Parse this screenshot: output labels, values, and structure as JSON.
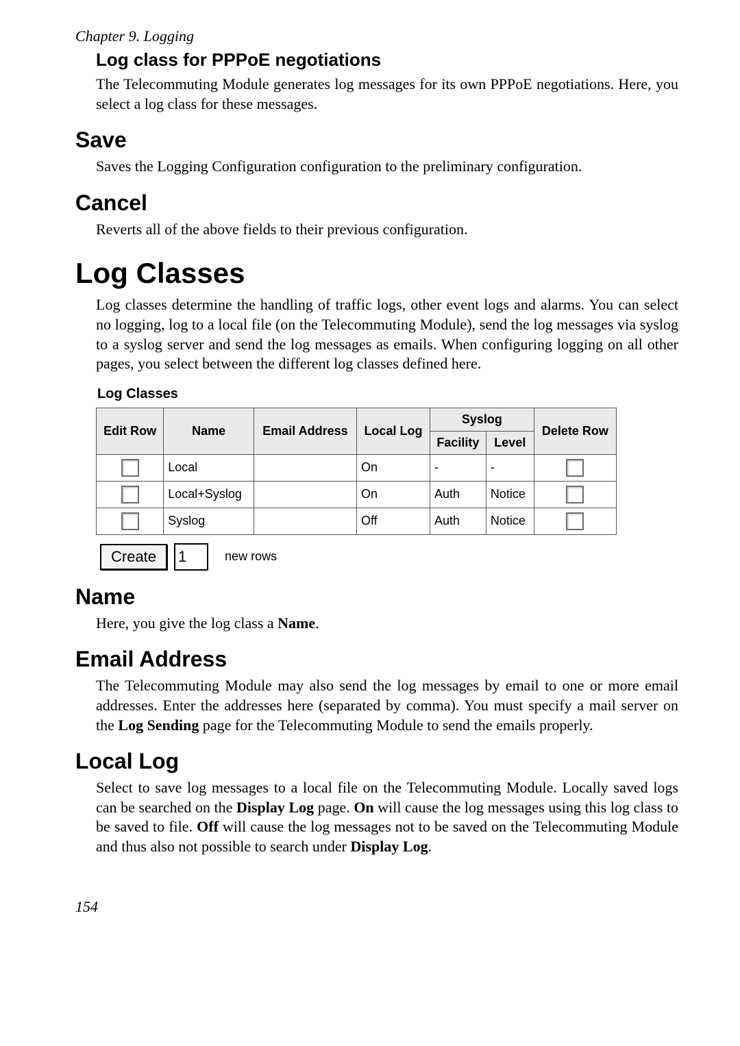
{
  "chapter": "Chapter 9. Logging",
  "section_pppoe": {
    "title": "Log class for PPPoE negotiations",
    "body": "The Telecommuting Module generates log messages for its own PPPoE negotiations. Here, you select a log class for these messages."
  },
  "section_save": {
    "title": "Save",
    "body": "Saves the Logging Configuration configuration to the preliminary configuration."
  },
  "section_cancel": {
    "title": "Cancel",
    "body": "Reverts all of the above fields to their previous configuration."
  },
  "section_logclasses": {
    "title": "Log Classes",
    "intro": "Log classes determine the handling of traffic logs, other event logs and alarms. You can select no logging, log to a local file (on the Telecommuting Module), send the log messages via syslog to a syslog server and send the log messages as emails. When configuring logging on all other pages, you select between the different log classes defined here.",
    "widget": {
      "title": "Log Classes",
      "headers": {
        "edit_row": "Edit Row",
        "name": "Name",
        "email": "Email Address",
        "local_log": "Local Log",
        "syslog": "Syslog",
        "facility": "Facility",
        "level": "Level",
        "delete_row": "Delete Row"
      },
      "rows": [
        {
          "name": "Local",
          "email": "",
          "local_log": "On",
          "facility": "-",
          "level": "-"
        },
        {
          "name": "Local+Syslog",
          "email": "",
          "local_log": "On",
          "facility": "Auth",
          "level": "Notice"
        },
        {
          "name": "Syslog",
          "email": "",
          "local_log": "Off",
          "facility": "Auth",
          "level": "Notice"
        }
      ],
      "create_button": "Create",
      "create_value": "1",
      "create_suffix": "new rows"
    }
  },
  "section_name": {
    "title": "Name",
    "body_prefix": "Here, you give the log class a ",
    "body_bold": "Name",
    "body_suffix": "."
  },
  "section_email": {
    "title": "Email Address",
    "body_prefix": "The Telecommuting Module may also send the log messages by email to one or more email addresses. Enter the addresses here (separated by comma). You must specify a mail server on the ",
    "body_bold": "Log Sending",
    "body_suffix": " page for the Telecommuting Module to send the emails properly."
  },
  "section_locallog": {
    "title": "Local Log",
    "body_1": "Select to save log messages to a local file on the Telecommuting Module. Locally saved logs can be searched on the ",
    "bold_1": "Display Log",
    "body_2": " page. ",
    "bold_2": "On",
    "body_3": " will cause the log messages using this log class to be saved to file. ",
    "bold_3": "Off",
    "body_4": " will cause the log messages not to be saved on the Telecommuting Module and thus also not possible to search under ",
    "bold_4": "Display Log",
    "body_5": "."
  },
  "page_number": "154"
}
